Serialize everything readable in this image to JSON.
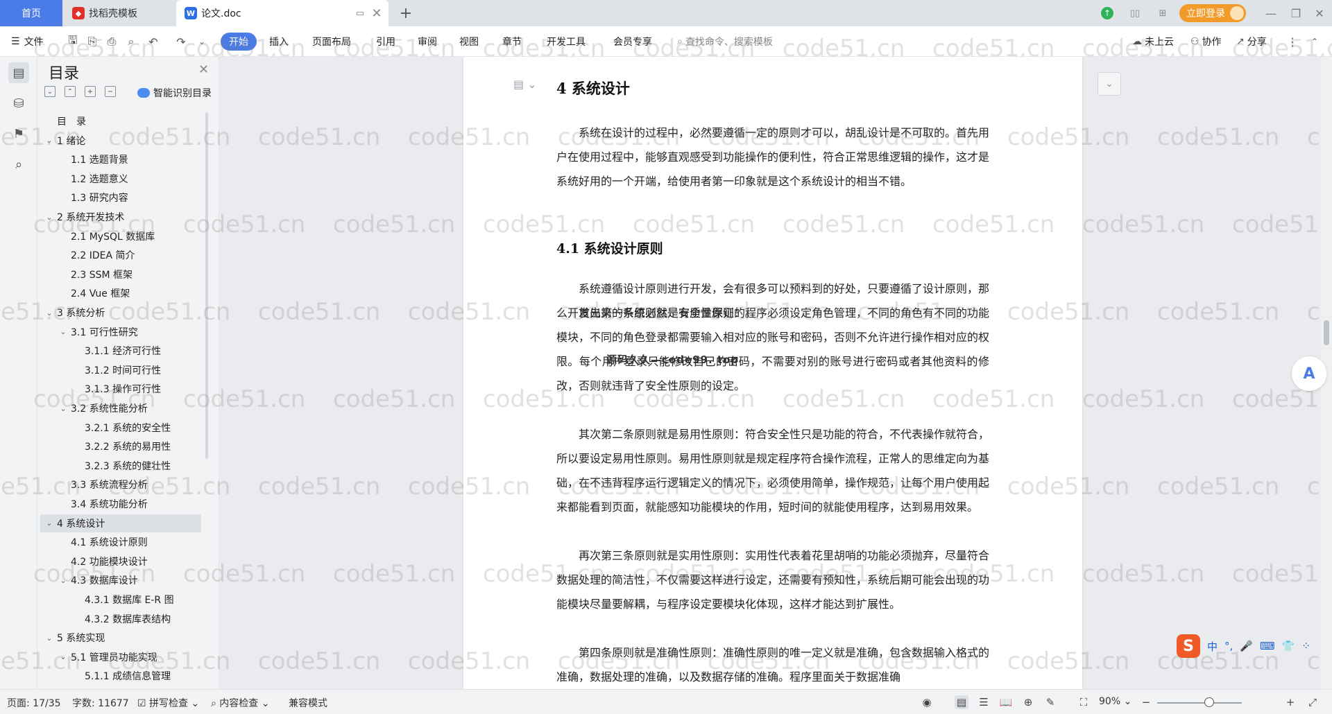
{
  "tabs": {
    "home": "首页",
    "daoke": "找稻壳模板",
    "doc": "论文.doc",
    "login": "立即登录"
  },
  "ribbon": {
    "file": "文件",
    "items": [
      "开始",
      "插入",
      "页面布局",
      "引用",
      "审阅",
      "视图",
      "章节",
      "开发工具",
      "会员专享"
    ],
    "search_placeholder": "查找命令、搜索模板",
    "cloud": "未上云",
    "collab": "协作",
    "share": "分享"
  },
  "toc": {
    "title": "目录",
    "smart": "智能识别目录",
    "items": [
      {
        "label": "目　录",
        "level": 0,
        "expand": ""
      },
      {
        "label": "1  绪论",
        "level": 0,
        "expand": "v"
      },
      {
        "label": "1.1  选题背景",
        "level": 1,
        "expand": ""
      },
      {
        "label": "1.2  选题意义",
        "level": 1,
        "expand": ""
      },
      {
        "label": "1.3  研究内容",
        "level": 1,
        "expand": ""
      },
      {
        "label": "2  系统开发技术",
        "level": 0,
        "expand": "v"
      },
      {
        "label": "2.1  MySQL 数据库",
        "level": 1,
        "expand": ""
      },
      {
        "label": "2.2  IDEA 简介",
        "level": 1,
        "expand": ""
      },
      {
        "label": "2.3  SSM 框架",
        "level": 1,
        "expand": ""
      },
      {
        "label": "2.4  Vue 框架",
        "level": 1,
        "expand": ""
      },
      {
        "label": "3  系统分析",
        "level": 0,
        "expand": "v"
      },
      {
        "label": "3.1  可行性研究",
        "level": 1,
        "expand": "v"
      },
      {
        "label": "3.1.1  经济可行性",
        "level": 2,
        "expand": ""
      },
      {
        "label": "3.1.2  时间可行性",
        "level": 2,
        "expand": ""
      },
      {
        "label": "3.1.3  操作可行性",
        "level": 2,
        "expand": ""
      },
      {
        "label": "3.2  系统性能分析",
        "level": 1,
        "expand": "v"
      },
      {
        "label": "3.2.1  系统的安全性",
        "level": 2,
        "expand": ""
      },
      {
        "label": "3.2.2  系统的易用性",
        "level": 2,
        "expand": ""
      },
      {
        "label": "3.2.3  系统的健壮性",
        "level": 2,
        "expand": ""
      },
      {
        "label": "3.3  系统流程分析",
        "level": 1,
        "expand": ""
      },
      {
        "label": "3.4  系统功能分析",
        "level": 1,
        "expand": ""
      },
      {
        "label": "4  系统设计",
        "level": 0,
        "expand": "v",
        "selected": true
      },
      {
        "label": "4.1  系统设计原则",
        "level": 1,
        "expand": ""
      },
      {
        "label": "4.2  功能模块设计",
        "level": 1,
        "expand": ""
      },
      {
        "label": "4.3  数据库设计",
        "level": 1,
        "expand": "v"
      },
      {
        "label": "4.3.1  数据库 E-R 图",
        "level": 2,
        "expand": ""
      },
      {
        "label": "4.3.2  数据库表结构",
        "level": 2,
        "expand": ""
      },
      {
        "label": "5  系统实现",
        "level": 0,
        "expand": "v"
      },
      {
        "label": "5.1  管理员功能实现",
        "level": 1,
        "expand": "v"
      },
      {
        "label": "5.1.1  成绩信息管理",
        "level": 2,
        "expand": ""
      }
    ]
  },
  "doc": {
    "chapter": "4  系统设计",
    "section": "4.1  系统设计原则",
    "paragraphs": [
      "系统在设计的过程中，必然要遵循一定的原则才可以，胡乱设计是不可取的。首先用户在使用过程中，能够直观感受到功能操作的便利性，符合正常思维逻辑的操作，这才是系统好用的一个开端，给使用者第一印象就是这个系统设计的相当不错。",
      "系统遵循设计原则进行开发，会有很多可以预料到的好处，只要遵循了设计原则，那么开发出来的系统必然是有质量保证的。",
      "首先第一条原则就是安全性原则：程序必须设定角色管理，不同的角色有不同的功能模块，不同的角色登录都需要输入相对应的账号和密码，否则不允许进行操作相对应的权限。每个用户登录只能修改自己的密码，不需要对别的账号进行密码或者其他资料的修改，否则就违背了安全性原则的设定。",
      "其次第二条原则就是易用性原则：符合安全性只是功能的符合，不代表操作就符合，所以要设定易用性原则。易用性原则就是规定程序符合操作流程，正常人的思维定向为基础，在不违背程序运行逻辑定义的情况下，必须使用简单，操作规范，让每个用户使用起来都能看到页面，就能感知功能模块的作用，短时间的就能使用程序，达到易用效果。",
      "再次第三条原则就是实用性原则：实用性代表着花里胡哨的功能必须抛弃，尽量符合数据处理的简洁性，不仅需要这样进行设定，还需要有预知性，系统后期可能会出现的功能模块尽量要解耦，与程序设定要模块化体现，这样才能达到扩展性。",
      "第四条原则就是准确性原则：准确性原则的唯一定义就是准确，包含数据输入格式的准确，数据处理的准确，以及数据存储的准确。程序里面关于数据准确"
    ],
    "center_watermark": "源码久久—code99. top",
    "watermark": "code51.cn"
  },
  "ime": {
    "logo": "S",
    "lang": "中",
    "punct": "°,"
  },
  "status": {
    "page": "页面: 17/35",
    "words": "字数: 11677",
    "spell": "拼写检查",
    "content_check": "内容检查",
    "compat": "兼容模式",
    "zoom": "90%"
  }
}
